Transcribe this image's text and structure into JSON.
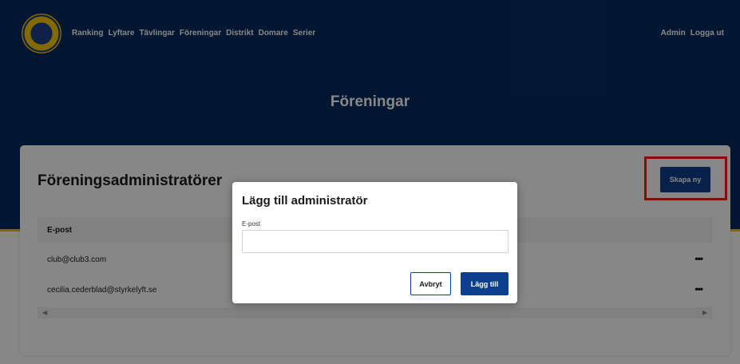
{
  "nav": {
    "items": [
      "Ranking",
      "Lyftare",
      "Tävlingar",
      "Föreningar",
      "Distrikt",
      "Domare",
      "Serier"
    ],
    "admin_label": "Admin",
    "logout_label": "Logga ut"
  },
  "page": {
    "title": "Föreningar"
  },
  "card": {
    "title": "Föreningsadministratörer",
    "create_button_label": "Skapa ny",
    "table": {
      "column_email": "E-post",
      "rows": [
        {
          "email": "club@club3.com",
          "actions": "•••"
        },
        {
          "email": "cecilia.cederblad@styrkelyft.se",
          "actions": "•••"
        }
      ]
    },
    "scroll_left_glyph": "◀",
    "scroll_right_glyph": "▶"
  },
  "modal": {
    "title": "Lägg till administratör",
    "email_label": "E-post",
    "email_value": "",
    "cancel_label": "Avbryt",
    "add_label": "Lägg till"
  },
  "colors": {
    "header_bg": "#012b5e",
    "accent_gold": "#f0c300",
    "primary_button": "#0e3f8e",
    "highlight": "#ff1a1a"
  },
  "icons": {
    "logo": "federation-logo-icon",
    "row_actions": "more-horizontal-icon"
  }
}
